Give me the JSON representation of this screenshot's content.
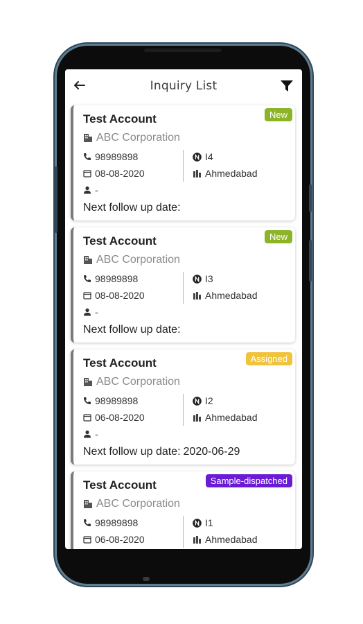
{
  "header": {
    "title": "Inquiry List"
  },
  "icons": {
    "back": "arrow-left-icon",
    "filter": "filter-icon",
    "company": "building-icon",
    "phone": "phone-icon",
    "date": "calendar-icon",
    "user": "user-icon",
    "number": "number-badge-icon",
    "city": "city-icon"
  },
  "colors": {
    "new": "#8db327",
    "assigned": "#f0c33c",
    "sample_dispatched": "#6a1bd6"
  },
  "follow_up_label": "Next follow up date:",
  "inquiries": [
    {
      "title": "Test Account",
      "company": "ABC Corporation",
      "phone": "98989898",
      "date": "08-08-2020",
      "user": "-",
      "id": "I4",
      "city": "Ahmedabad",
      "status": "New",
      "status_color": "#8db327",
      "next_follow_up": ""
    },
    {
      "title": "Test Account",
      "company": "ABC Corporation",
      "phone": "98989898",
      "date": "08-08-2020",
      "user": "-",
      "id": "I3",
      "city": "Ahmedabad",
      "status": "New",
      "status_color": "#8db327",
      "next_follow_up": ""
    },
    {
      "title": "Test Account",
      "company": "ABC Corporation",
      "phone": "98989898",
      "date": "06-08-2020",
      "user": "-",
      "id": "I2",
      "city": "Ahmedabad",
      "status": "Assigned",
      "status_color": "#f0c33c",
      "next_follow_up": "2020-06-29"
    },
    {
      "title": "Test Account",
      "company": "ABC Corporation",
      "phone": "98989898",
      "date": "06-08-2020",
      "user": "",
      "id": "I1",
      "city": "Ahmedabad",
      "status": "Sample-dispatched",
      "status_color": "#6a1bd6",
      "next_follow_up": ""
    }
  ]
}
